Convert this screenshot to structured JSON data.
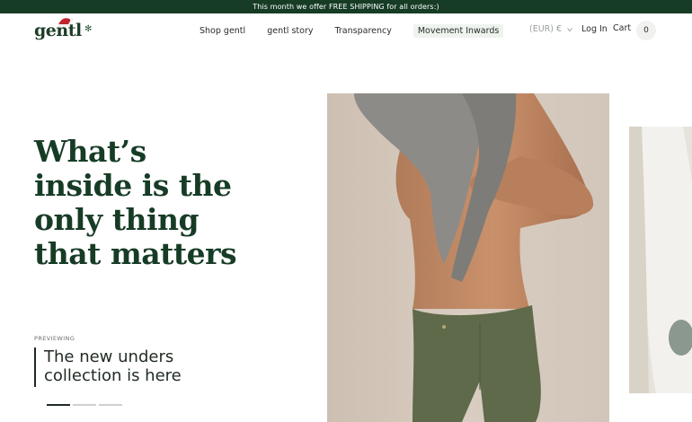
{
  "announcement": "This month we offer FREE SHIPPING for all orders:)",
  "logo": {
    "text": "gentl"
  },
  "nav": {
    "items": [
      "Shop gentl",
      "gentl story",
      "Transparency",
      "Movement Inwards"
    ]
  },
  "currency": {
    "label": "(EUR) €"
  },
  "account": {
    "login_label": "Log In"
  },
  "cart": {
    "label": "Cart",
    "count": "0"
  },
  "hero": {
    "headline": "What’s\ninside is the\nonly thing\nthat matters",
    "previewing_label": "PREVIEWING",
    "collection_text": "The new unders\ncollection is here",
    "slides_total": 3,
    "slide_active": 1
  },
  "colors": {
    "brand_green": "#173c26",
    "announcement_bg": "#173c26",
    "text_dark": "#1f2a22",
    "muted": "#9aa09b",
    "shorts_olive": "#5f6a4a"
  },
  "icons": [
    "santa-hat-icon",
    "snowflake-icon",
    "chevron-down-icon"
  ]
}
